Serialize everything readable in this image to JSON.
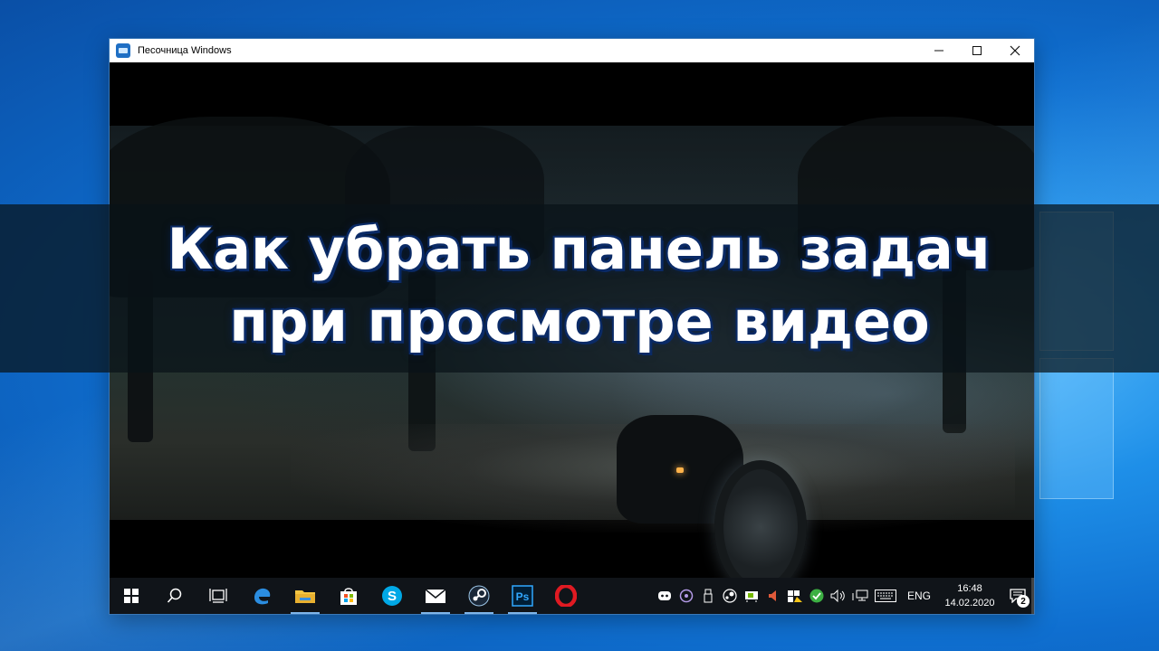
{
  "window": {
    "title": "Песочница Windows",
    "controls": {
      "minimize": "—",
      "maximize": "☐",
      "close": "✕"
    }
  },
  "headline": {
    "line1": "Как убрать панель задач",
    "line2": "при просмотре видео"
  },
  "taskbar": {
    "apps": [
      {
        "name": "start-button",
        "icon": "windows-logo-icon"
      },
      {
        "name": "search-button",
        "icon": "search-icon"
      },
      {
        "name": "task-view-button",
        "icon": "task-view-icon"
      },
      {
        "name": "edge-button",
        "icon": "edge-icon"
      },
      {
        "name": "file-explorer-button",
        "icon": "folder-icon"
      },
      {
        "name": "store-button",
        "icon": "store-icon"
      },
      {
        "name": "skype-button",
        "icon": "skype-icon"
      },
      {
        "name": "mail-button",
        "icon": "mail-icon"
      },
      {
        "name": "steam-button",
        "icon": "steam-icon"
      },
      {
        "name": "photoshop-button",
        "icon": "photoshop-icon"
      },
      {
        "name": "opera-button",
        "icon": "opera-icon"
      }
    ],
    "photoshop_label": "Ps",
    "skype_label": "S",
    "tray": {
      "language": "ENG",
      "time": "16:48",
      "date": "14.02.2020",
      "notification_count": "2"
    }
  },
  "colors": {
    "desktop": "#0f6fd0",
    "taskbar": "#101419",
    "headline_outline": "#0a2a66",
    "edge": "#2b8de0",
    "folder": "#f4c542",
    "skype": "#00a8e6",
    "opera": "#e01a22",
    "photoshop": "#31a8ff"
  }
}
